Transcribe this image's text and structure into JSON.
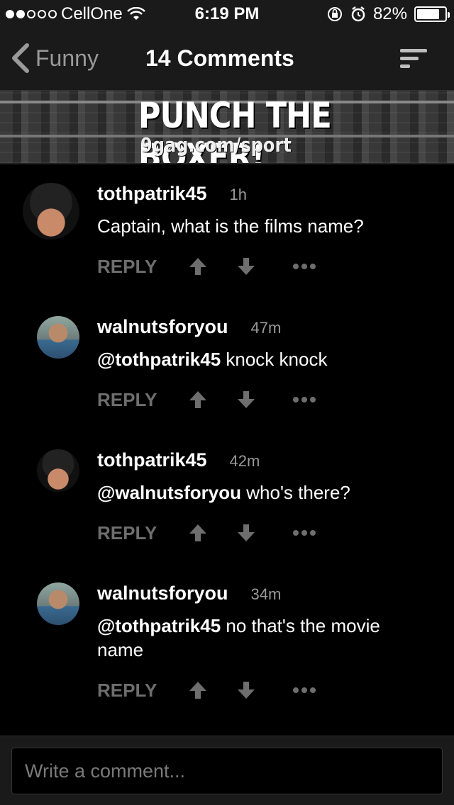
{
  "status_bar": {
    "carrier": "CellOne",
    "time": "6:19 PM",
    "battery": "82%",
    "battery_level": 0.82,
    "signal_dots_filled": 2,
    "signal_dots_total": 5
  },
  "nav": {
    "back_label": "Funny",
    "title": "14 Comments"
  },
  "banner": {
    "headline": "PUNCH THE BOXER!",
    "subline": "9gag.com/sport"
  },
  "comments": [
    {
      "username": "tothpatrik45",
      "age": "1h",
      "mention": "",
      "text": "Captain,  what is the films name?",
      "avatar": "batman"
    },
    {
      "username": "walnutsforyou",
      "age": "47m",
      "mention": "@tothpatrik45",
      "text": " knock knock",
      "avatar": "bald"
    },
    {
      "username": "tothpatrik45",
      "age": "42m",
      "mention": "@walnutsforyou",
      "text": " who's there?",
      "avatar": "batman"
    },
    {
      "username": "walnutsforyou",
      "age": "34m",
      "mention": "@tothpatrik45",
      "text": " no that's the movie name",
      "avatar": "bald"
    }
  ],
  "actions": {
    "reply_label": "REPLY",
    "upvote_icon": "arrow-up-icon",
    "downvote_icon": "arrow-down-icon",
    "more_icon": "more-icon"
  },
  "composer": {
    "placeholder": "Write a comment..."
  },
  "colors": {
    "background": "#000000",
    "bar": "#1a1a1a",
    "muted": "#6e6e6e",
    "secondary": "#9a9a9a"
  }
}
